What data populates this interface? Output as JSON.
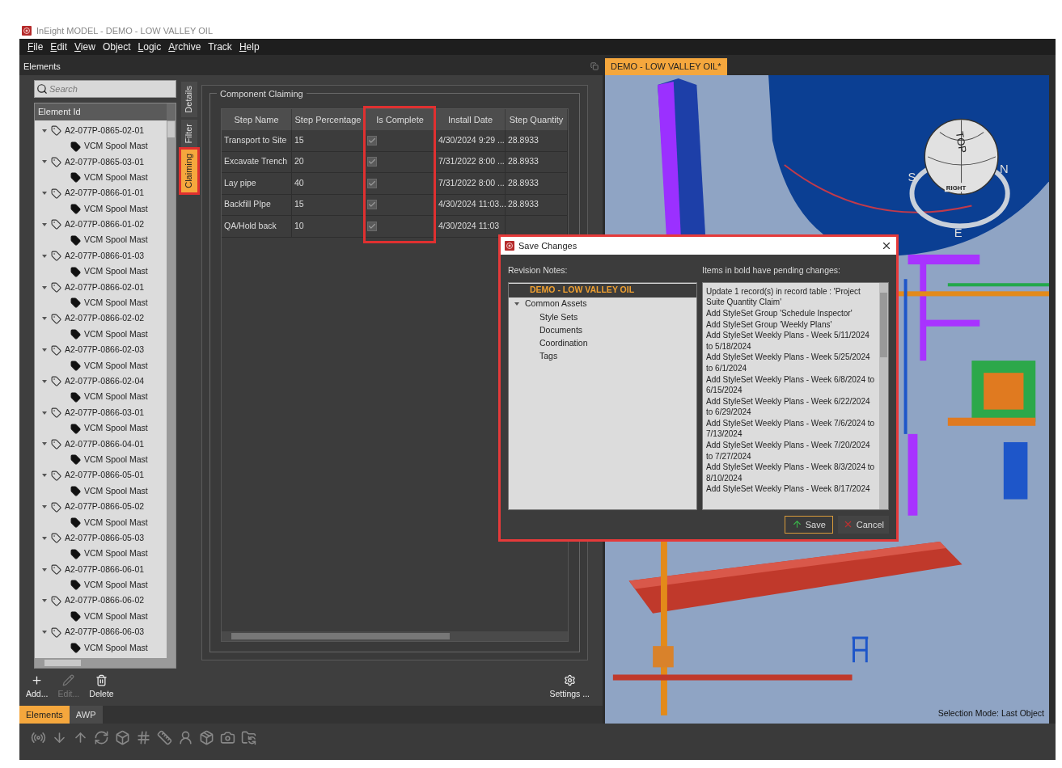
{
  "window": {
    "title": "InEight MODEL - DEMO - LOW VALLEY OIL"
  },
  "menu": [
    {
      "label": "File",
      "underlined": true
    },
    {
      "label": "Edit",
      "underlined": true
    },
    {
      "label": "View",
      "underlined": true
    },
    {
      "label": "Object",
      "underlined": false
    },
    {
      "label": "Logic",
      "underlined": true
    },
    {
      "label": "Archive",
      "underlined": true
    },
    {
      "label": "Track",
      "underlined": false
    },
    {
      "label": "Help",
      "underlined": true
    }
  ],
  "elements_panel": {
    "title": "Elements",
    "search": {
      "placeholder": "Search"
    },
    "tree": {
      "column": "Element Id",
      "items": [
        {
          "label": "A2-077P-0865-02-01",
          "expanded": true,
          "children": [
            {
              "label": "VCM Spool Mast"
            }
          ]
        },
        {
          "label": "A2-077P-0865-03-01",
          "expanded": true,
          "children": [
            {
              "label": "VCM Spool Mast"
            }
          ]
        },
        {
          "label": "A2-077P-0866-01-01",
          "expanded": true,
          "children": [
            {
              "label": "VCM Spool Mast"
            }
          ]
        },
        {
          "label": "A2-077P-0866-01-02",
          "expanded": true,
          "children": [
            {
              "label": "VCM Spool Mast"
            }
          ]
        },
        {
          "label": "A2-077P-0866-01-03",
          "expanded": true,
          "children": [
            {
              "label": "VCM Spool Mast"
            }
          ]
        },
        {
          "label": "A2-077P-0866-02-01",
          "expanded": true,
          "children": [
            {
              "label": "VCM Spool Mast"
            }
          ]
        },
        {
          "label": "A2-077P-0866-02-02",
          "expanded": true,
          "children": [
            {
              "label": "VCM Spool Mast"
            }
          ]
        },
        {
          "label": "A2-077P-0866-02-03",
          "expanded": true,
          "children": [
            {
              "label": "VCM Spool Mast"
            }
          ]
        },
        {
          "label": "A2-077P-0866-02-04",
          "expanded": true,
          "children": [
            {
              "label": "VCM Spool Mast"
            }
          ]
        },
        {
          "label": "A2-077P-0866-03-01",
          "expanded": true,
          "children": [
            {
              "label": "VCM Spool Mast"
            }
          ]
        },
        {
          "label": "A2-077P-0866-04-01",
          "expanded": true,
          "children": [
            {
              "label": "VCM Spool Mast"
            }
          ]
        },
        {
          "label": "A2-077P-0866-05-01",
          "expanded": true,
          "children": [
            {
              "label": "VCM Spool Mast"
            }
          ]
        },
        {
          "label": "A2-077P-0866-05-02",
          "expanded": true,
          "children": [
            {
              "label": "VCM Spool Mast"
            }
          ]
        },
        {
          "label": "A2-077P-0866-05-03",
          "expanded": true,
          "children": [
            {
              "label": "VCM Spool Mast"
            }
          ]
        },
        {
          "label": "A2-077P-0866-06-01",
          "expanded": true,
          "children": [
            {
              "label": "VCM Spool Mast"
            }
          ]
        },
        {
          "label": "A2-077P-0866-06-02",
          "expanded": true,
          "children": [
            {
              "label": "VCM Spool Mast"
            }
          ]
        },
        {
          "label": "A2-077P-0866-06-03",
          "expanded": true,
          "children": [
            {
              "label": "VCM Spool Mast"
            }
          ]
        }
      ]
    }
  },
  "side_tabs": [
    {
      "label": "Details",
      "selected": false,
      "highlighted": false
    },
    {
      "label": "Filter",
      "selected": false,
      "highlighted": false
    },
    {
      "label": "Claiming",
      "selected": true,
      "highlighted": true
    }
  ],
  "claiming": {
    "title": "Component Claiming",
    "columns": [
      {
        "label": "Step Name",
        "highlighted": false
      },
      {
        "label": "Step Percentage",
        "highlighted": false
      },
      {
        "label": "Is Complete",
        "highlighted": true
      },
      {
        "label": "Install Date",
        "highlighted": false
      },
      {
        "label": "Step Quantity",
        "highlighted": false
      }
    ],
    "rows": [
      {
        "step_name": "Transport to Site",
        "step_percentage": "15",
        "is_complete": true,
        "install_date": "4/30/2024 9:29 ...",
        "step_quantity": "28.8933"
      },
      {
        "step_name": "Excavate Trench",
        "step_percentage": "20",
        "is_complete": true,
        "install_date": "7/31/2022 8:00 ...",
        "step_quantity": "28.8933"
      },
      {
        "step_name": "Lay pipe",
        "step_percentage": "40",
        "is_complete": true,
        "install_date": "7/31/2022 8:00 ...",
        "step_quantity": "28.8933"
      },
      {
        "step_name": "Backfill PIpe",
        "step_percentage": "15",
        "is_complete": true,
        "install_date": "4/30/2024 11:03...",
        "step_quantity": "28.8933"
      },
      {
        "step_name": "QA/Hold back",
        "step_percentage": "10",
        "is_complete": true,
        "install_date": "4/30/2024 11:03"
      }
    ]
  },
  "actions": [
    {
      "label": "Add...",
      "kind": "add",
      "disabled": false
    },
    {
      "label": "Edit...",
      "kind": "edit",
      "disabled": true
    },
    {
      "label": "Delete",
      "kind": "delete",
      "disabled": false
    }
  ],
  "settings": {
    "label": "Settings ..."
  },
  "bottom_tabs": [
    {
      "label": "Elements",
      "selected": true
    },
    {
      "label": "AWP",
      "selected": false
    }
  ],
  "viewport": {
    "tab": "DEMO - LOW VALLEY OIL*",
    "view_cube": {
      "top": "TOP",
      "right": "RIGHT",
      "compass": [
        "S",
        "N",
        "E"
      ]
    },
    "status": "Selection Mode: Last Object"
  },
  "dialog": {
    "title": "Save Changes",
    "highlighted": true,
    "notes_label": "Revision Notes:",
    "tree": [
      {
        "label": "DEMO - LOW VALLEY OIL",
        "selected": true
      },
      {
        "label": "Common Assets",
        "selected": false,
        "expanded": true,
        "children": [
          {
            "label": "Style Sets",
            "selected": false
          },
          {
            "label": "Documents",
            "selected": false
          },
          {
            "label": "Coordination",
            "selected": false
          },
          {
            "label": "Tags",
            "selected": false
          }
        ]
      }
    ],
    "changes_label": "Items in bold have pending changes:",
    "changes": [
      "Update 1 record(s) in record table : 'Project Suite Quantity Claim'",
      "Add StyleSet Group 'Schedule Inspector'",
      "Add StyleSet Group 'Weekly Plans'",
      "Add StyleSet Weekly Plans - Week 5/11/2024 to 5/18/2024",
      "Add StyleSet Weekly Plans - Week 5/25/2024 to 6/1/2024",
      "Add StyleSet Weekly Plans - Week 6/8/2024 to 6/15/2024",
      "Add StyleSet Weekly Plans - Week 6/22/2024 to 6/29/2024",
      "Add StyleSet Weekly Plans - Week 7/6/2024 to 7/13/2024",
      "Add StyleSet Weekly Plans - Week 7/20/2024 to 7/27/2024",
      "Add StyleSet Weekly Plans - Week 8/3/2024 to 8/10/2024",
      "Add StyleSet Weekly Plans - Week 8/17/2024"
    ],
    "buttons": [
      {
        "label": "Save",
        "kind": "save"
      },
      {
        "label": "Cancel",
        "kind": "cancel"
      }
    ]
  }
}
